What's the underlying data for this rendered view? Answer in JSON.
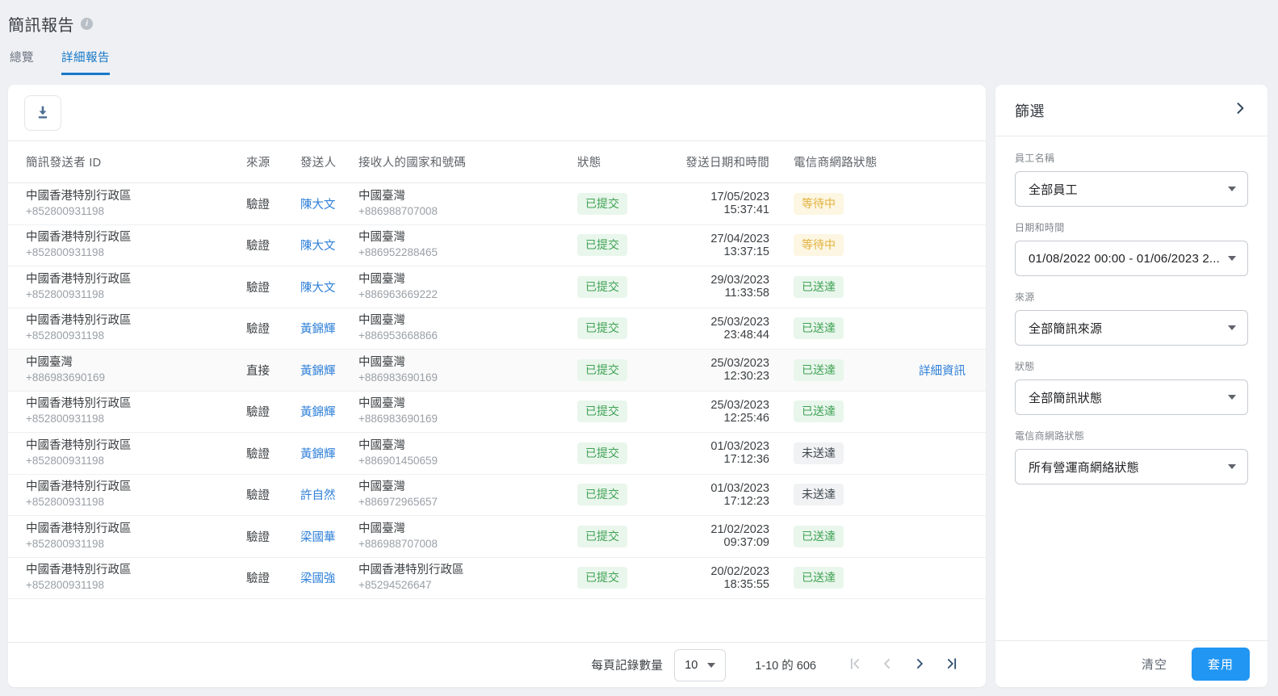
{
  "header": {
    "title": "簡訊報告",
    "tabs": [
      {
        "label": "總覽"
      },
      {
        "label": "詳細報告"
      }
    ]
  },
  "table": {
    "headers": [
      "簡訊發送者 ID",
      "來源",
      "發送人",
      "接收人的國家和號碼",
      "狀態",
      "發送日期和時間",
      "電信商網路狀態"
    ],
    "rows": [
      {
        "sender_country": "中國香港特別行政區",
        "sender_number": "+852800931198",
        "source": "驗證",
        "agent": "陳大文",
        "recipient_country": "中國臺灣",
        "recipient_number": "+886988707008",
        "status": "已提交",
        "status_type": "submitted",
        "datetime": "17/05/2023 15:37:41",
        "carrier_status": "等待中",
        "carrier_status_type": "pending"
      },
      {
        "sender_country": "中國香港特別行政區",
        "sender_number": "+852800931198",
        "source": "驗證",
        "agent": "陳大文",
        "recipient_country": "中國臺灣",
        "recipient_number": "+886952288465",
        "status": "已提交",
        "status_type": "submitted",
        "datetime": "27/04/2023 13:37:15",
        "carrier_status": "等待中",
        "carrier_status_type": "pending"
      },
      {
        "sender_country": "中國香港特別行政區",
        "sender_number": "+852800931198",
        "source": "驗證",
        "agent": "陳大文",
        "recipient_country": "中國臺灣",
        "recipient_number": "+886963669222",
        "status": "已提交",
        "status_type": "submitted",
        "datetime": "29/03/2023 11:33:58",
        "carrier_status": "已送達",
        "carrier_status_type": "delivered"
      },
      {
        "sender_country": "中國香港特別行政區",
        "sender_number": "+852800931198",
        "source": "驗證",
        "agent": "黃錦輝",
        "recipient_country": "中國臺灣",
        "recipient_number": "+886953668866",
        "status": "已提交",
        "status_type": "submitted",
        "datetime": "25/03/2023 23:48:44",
        "carrier_status": "已送達",
        "carrier_status_type": "delivered"
      },
      {
        "sender_country": "中國臺灣",
        "sender_number": "+886983690169",
        "source": "直接",
        "agent": "黃錦輝",
        "recipient_country": "中國臺灣",
        "recipient_number": "+886983690169",
        "status": "已提交",
        "status_type": "submitted",
        "datetime": "25/03/2023 12:30:23",
        "carrier_status": "已送達",
        "carrier_status_type": "delivered",
        "hovered": true,
        "detail_label": "詳細資訊"
      },
      {
        "sender_country": "中國香港特別行政區",
        "sender_number": "+852800931198",
        "source": "驗證",
        "agent": "黃錦輝",
        "recipient_country": "中國臺灣",
        "recipient_number": "+886983690169",
        "status": "已提交",
        "status_type": "submitted",
        "datetime": "25/03/2023 12:25:46",
        "carrier_status": "已送達",
        "carrier_status_type": "delivered"
      },
      {
        "sender_country": "中國香港特別行政區",
        "sender_number": "+852800931198",
        "source": "驗證",
        "agent": "黃錦輝",
        "recipient_country": "中國臺灣",
        "recipient_number": "+886901450659",
        "status": "已提交",
        "status_type": "submitted",
        "datetime": "01/03/2023 17:12:36",
        "carrier_status": "未送達",
        "carrier_status_type": "undelivered"
      },
      {
        "sender_country": "中國香港特別行政區",
        "sender_number": "+852800931198",
        "source": "驗證",
        "agent": "許自然",
        "recipient_country": "中國臺灣",
        "recipient_number": "+886972965657",
        "status": "已提交",
        "status_type": "submitted",
        "datetime": "01/03/2023 17:12:23",
        "carrier_status": "未送達",
        "carrier_status_type": "undelivered"
      },
      {
        "sender_country": "中國香港特別行政區",
        "sender_number": "+852800931198",
        "source": "驗證",
        "agent": "梁國華",
        "recipient_country": "中國臺灣",
        "recipient_number": "+886988707008",
        "status": "已提交",
        "status_type": "submitted",
        "datetime": "21/02/2023 09:37:09",
        "carrier_status": "已送達",
        "carrier_status_type": "delivered"
      },
      {
        "sender_country": "中國香港特別行政區",
        "sender_number": "+852800931198",
        "source": "驗證",
        "agent": "梁國強",
        "recipient_country": "中國香港特別行政區",
        "recipient_number": "+85294526647",
        "status": "已提交",
        "status_type": "submitted",
        "datetime": "20/02/2023 18:35:55",
        "carrier_status": "已送達",
        "carrier_status_type": "delivered"
      }
    ]
  },
  "pagination": {
    "per_page_label": "每頁記錄數量",
    "page_size": "10",
    "range_text": "1-10 的 606"
  },
  "filters": {
    "title": "篩選",
    "fields": [
      {
        "label": "員工名稱",
        "value": "全部員工"
      },
      {
        "label": "日期和時間",
        "value": "01/08/2022 00:00 - 01/06/2023 2..."
      },
      {
        "label": "來源",
        "value": "全部簡訊來源"
      },
      {
        "label": "狀態",
        "value": "全部簡訊狀態"
      },
      {
        "label": "電信商網路狀態",
        "value": "所有營運商網絡狀態"
      }
    ],
    "clear_label": "清空",
    "apply_label": "套用"
  },
  "colors": {
    "accent_blue": "#2196f3",
    "link_blue": "#2f80d8",
    "tab_active_blue": "#1778c8",
    "badge_green_bg": "#e9f6ec",
    "badge_green_text": "#3fa254",
    "badge_yellow_bg": "#fcf6e2",
    "badge_yellow_text": "#e2b13c",
    "badge_gray_bg": "#f1f2f3",
    "badge_gray_text": "#3f4750"
  }
}
